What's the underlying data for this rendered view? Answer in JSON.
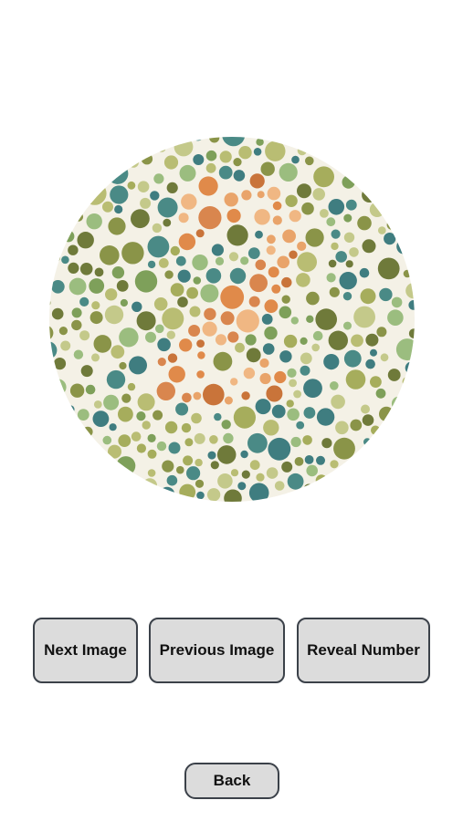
{
  "plate": {
    "hidden_number": "2",
    "colors": {
      "background_dots": [
        "#6f7a3a",
        "#8a9448",
        "#a6ad5c",
        "#b9bd73",
        "#c4c98a",
        "#9bbd7f",
        "#4a8a86",
        "#3f7d80",
        "#7ea05a"
      ],
      "figure_dots": [
        "#e08a4a",
        "#e9a46a",
        "#c9743a",
        "#f0b783",
        "#d9864e"
      ]
    }
  },
  "buttons": {
    "next_label": "Next Image",
    "previous_label": "Previous Image",
    "reveal_label": "Reveal Number",
    "back_label": "Back"
  }
}
